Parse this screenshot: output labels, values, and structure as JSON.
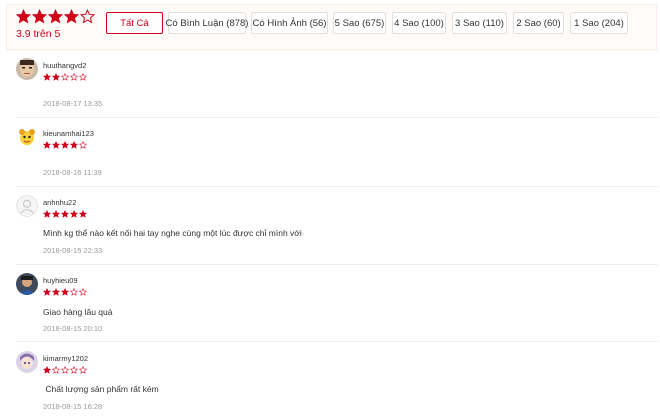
{
  "overview": {
    "rating": 3.9,
    "score_text": "3.9 trên 5",
    "accent": "#d0011b"
  },
  "filters": [
    {
      "label": "Tất Cả",
      "active": true
    },
    {
      "label": "Có Bình Luận (878)",
      "active": false
    },
    {
      "label": "Có Hình Ảnh (56)",
      "active": false
    },
    {
      "label": "5 Sao (675)",
      "active": false
    },
    {
      "label": "4 Sao (100)",
      "active": false
    },
    {
      "label": "3 Sao (110)",
      "active": false
    },
    {
      "label": "2 Sao (60)",
      "active": false
    },
    {
      "label": "1 Sao (204)",
      "active": false
    }
  ],
  "reviews": [
    {
      "username": "huuthangvd2",
      "stars": 2,
      "comment": "",
      "timestamp": "2018-08-17 13:35",
      "avatar": "face-photo-avatar"
    },
    {
      "username": "kieunamhai123",
      "stars": 4,
      "comment": "",
      "timestamp": "2018-08-16 11:39",
      "avatar": "cartoon-avatar"
    },
    {
      "username": "anhnhu22",
      "stars": 5,
      "comment": "Mình kg thể nào kết nối hai tay nghe cùng một lúc được chỉ mình với",
      "timestamp": "2018-08-15 22:33",
      "avatar": "default-user-avatar"
    },
    {
      "username": "huyhieu09",
      "stars": 3,
      "comment": "Giao hàng lâu quá",
      "timestamp": "2018-08-15 20:10",
      "avatar": "photo-avatar"
    },
    {
      "username": "kimarmy1202",
      "stars": 1,
      "comment": " Chất lượng sản phẩm rất kém",
      "timestamp": "2018-08-15 16:28",
      "avatar": "anime-avatar"
    }
  ]
}
